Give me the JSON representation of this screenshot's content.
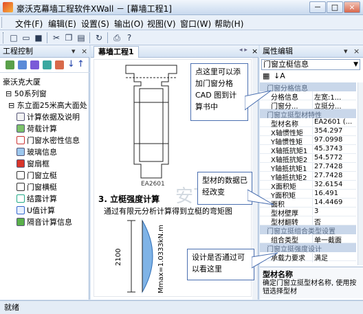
{
  "window": {
    "title": "豪沃克幕墙工程软件XWall － [幕墙工程1]",
    "controls": [
      "－",
      "□",
      "×"
    ]
  },
  "menu": [
    "文件(F)",
    "编辑(E)",
    "设置(S)",
    "输出(O)",
    "视图(V)",
    "窗口(W)",
    "帮助(H)"
  ],
  "left_panel": {
    "title": "工程控制",
    "pin": "▾",
    "close": "×",
    "tree": {
      "root": "豪沃克大厦",
      "series": "50系列窗",
      "facade": "东立面25米高大面处",
      "items": [
        "计算依据及说明",
        "荷载计算",
        "门窗水密性信息",
        "玻璃信息",
        "窗扇框",
        "门窗立梃",
        "门窗横梃",
        "结露计算",
        "U值计算",
        "隔音计算信息"
      ]
    }
  },
  "doc": {
    "tab": "幕墙工程1",
    "profile_label": "EA2601",
    "section_title": "3. 立梃强度计算",
    "section_text": "通过有限元分析计算得到立梃的弯矩图",
    "dimension": "2100",
    "moment_label": "Mmax=1.0333kN.m"
  },
  "right_panel": {
    "title": "属性编辑",
    "dropdown": "门窗立梃信息",
    "groups": [
      {
        "title": "门窗分格信息",
        "rows": [
          [
            "分格信息",
            "左宽:1..."
          ],
          [
            "门窗分...",
            "立挺分..."
          ]
        ]
      },
      {
        "title": "门窗立挺型材特性",
        "rows": [
          [
            "型材名称",
            "EA2601 (..."
          ],
          [
            "X轴惯性矩",
            "354.297"
          ],
          [
            "Y轴惯性矩",
            "97.0998"
          ],
          [
            "X轴抵抗矩1",
            "45.3743"
          ],
          [
            "X轴抵抗矩2",
            "54.5772"
          ],
          [
            "Y轴抵抗矩1",
            "27.7428"
          ],
          [
            "Y轴抵抗矩2",
            "27.7428"
          ],
          [
            "X面积矩",
            "32.6154"
          ],
          [
            "Y面积矩",
            "16.491"
          ],
          [
            "面积",
            "14.4469"
          ],
          [
            "型材壁厚",
            "3"
          ],
          [
            "型材翻转",
            "否"
          ]
        ]
      },
      {
        "title": "门窗立挺组合类型设置",
        "rows": [
          [
            "组合类型",
            "单一截面"
          ]
        ]
      },
      {
        "title": "门窗立挺强度设计",
        "rows": [
          [
            "承载力要求",
            "满足"
          ]
        ]
      }
    ],
    "help_title": "型材名称",
    "help_text": "确定门窗立挺型材名称, 使用按钮选择型材"
  },
  "callouts": {
    "top": "点这里可以添加门窗分格 CAD 图到计算书中",
    "middle": "型材的数据已经改变",
    "bottom": "设计是否通过可以看这里"
  },
  "watermark": "安下载 anxz.com",
  "status": "就绪"
}
